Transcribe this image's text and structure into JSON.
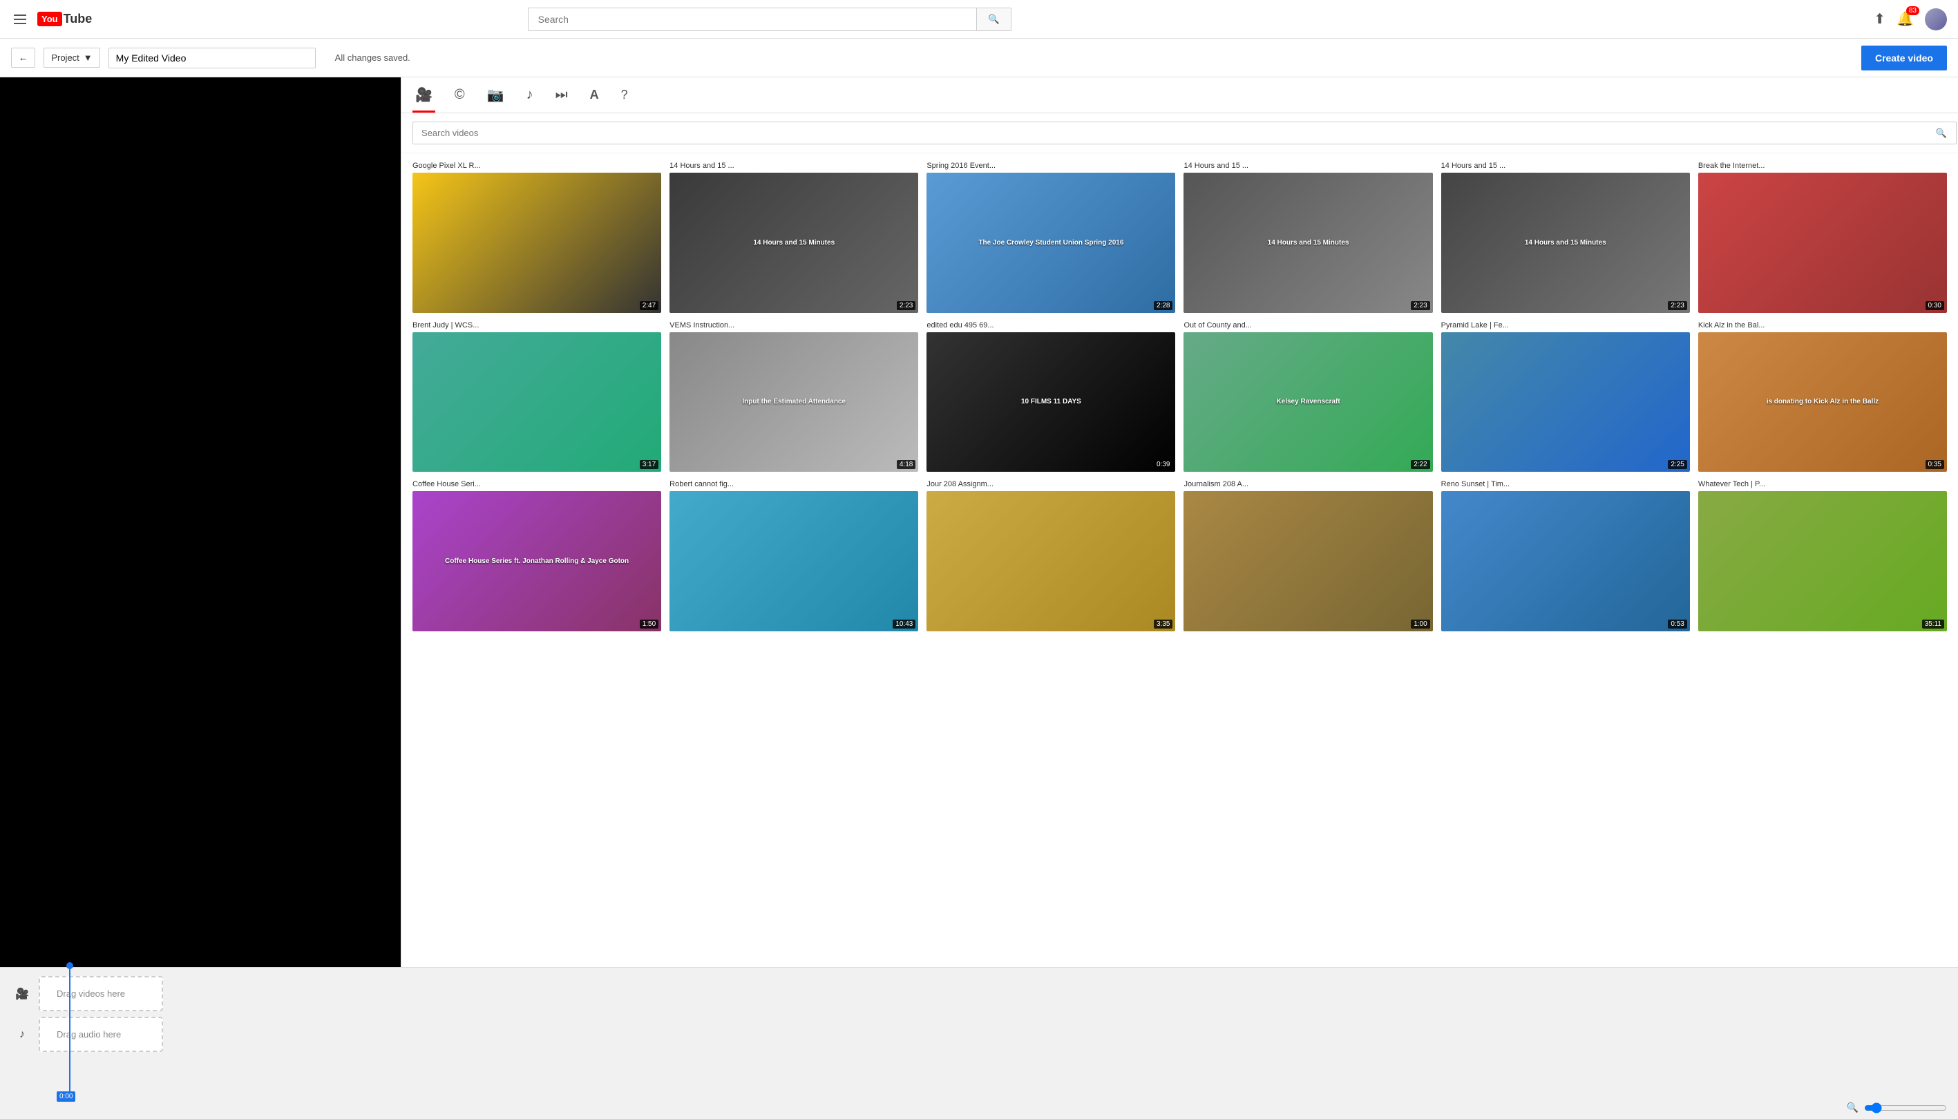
{
  "nav": {
    "search_placeholder": "Search",
    "search_icon": "🔍",
    "upload_label": "Upload",
    "notifications_count": "83",
    "logo_box": "You",
    "logo_text": "Tube"
  },
  "toolbar": {
    "back_label": "←",
    "project_label": "Project",
    "project_dropdown_arrow": "▼",
    "project_name": "My Edited Video",
    "save_status": "All changes saved.",
    "create_video_label": "Create video"
  },
  "tabs": [
    {
      "id": "video",
      "icon": "🎥",
      "active": true
    },
    {
      "id": "captions",
      "icon": "©"
    },
    {
      "id": "photo",
      "icon": "📷"
    },
    {
      "id": "music",
      "icon": "♪"
    },
    {
      "id": "transition",
      "icon": "⏭"
    },
    {
      "id": "text",
      "icon": "A"
    },
    {
      "id": "help",
      "icon": "?"
    }
  ],
  "search": {
    "placeholder": "Search videos"
  },
  "videos": [
    {
      "title": "Google Pixel XL R...",
      "duration": "2:47",
      "thumb_class": "thumb-1",
      "overlay": ""
    },
    {
      "title": "14 Hours and 15 ...",
      "duration": "2:23",
      "thumb_class": "thumb-2",
      "overlay": "14 Hours and 15 Minutes"
    },
    {
      "title": "Spring 2016 Event...",
      "duration": "2:28",
      "thumb_class": "thumb-3",
      "overlay": "The Joe Crowley Student Union Spring 2016"
    },
    {
      "title": "14 Hours and 15 ...",
      "duration": "2:23",
      "thumb_class": "thumb-4",
      "overlay": "14 Hours and 15 Minutes"
    },
    {
      "title": "14 Hours and 15 ...",
      "duration": "2:23",
      "thumb_class": "thumb-5",
      "overlay": "14 Hours and 15 Minutes"
    },
    {
      "title": "Break the Internet...",
      "duration": "0:30",
      "thumb_class": "thumb-6",
      "overlay": ""
    },
    {
      "title": "Brent Judy | WCS...",
      "duration": "3:17",
      "thumb_class": "thumb-7",
      "overlay": ""
    },
    {
      "title": "VEMS Instruction...",
      "duration": "4:18",
      "thumb_class": "thumb-8",
      "overlay": "Input the Estimated Attendance"
    },
    {
      "title": "edited edu 495 69...",
      "duration": "0:39",
      "thumb_class": "thumb-9",
      "overlay": "10 FILMS 11 DAYS"
    },
    {
      "title": "Out of County and...",
      "duration": "2:22",
      "thumb_class": "thumb-10",
      "overlay": "Kelsey Ravenscraft"
    },
    {
      "title": "Pyramid Lake | Fe...",
      "duration": "2:25",
      "thumb_class": "thumb-11",
      "overlay": ""
    },
    {
      "title": "Kick Alz in the Bal...",
      "duration": "0:35",
      "thumb_class": "thumb-12",
      "overlay": "is donating to Kick Alz in the Ballz"
    },
    {
      "title": "Coffee House Seri...",
      "duration": "1:50",
      "thumb_class": "thumb-13",
      "overlay": "Coffee House Series ft. Jonathan Rolling & Jayce Goton"
    },
    {
      "title": "Robert cannot fig...",
      "duration": "10:43",
      "thumb_class": "thumb-14",
      "overlay": ""
    },
    {
      "title": "Jour 208 Assignm...",
      "duration": "3:35",
      "thumb_class": "thumb-15",
      "overlay": ""
    },
    {
      "title": "Journalism 208 A...",
      "duration": "1:00",
      "thumb_class": "thumb-16",
      "overlay": ""
    },
    {
      "title": "Reno Sunset | Tim...",
      "duration": "0:53",
      "thumb_class": "thumb-17",
      "overlay": ""
    },
    {
      "title": "Whatever Tech | P...",
      "duration": "35:11",
      "thumb_class": "thumb-18",
      "overlay": ""
    }
  ],
  "timeline": {
    "video_track_icon": "🎥",
    "audio_track_icon": "♪",
    "drag_video_label": "Drag videos here",
    "drag_audio_label": "Drag audio here",
    "cursor_time": "0:00"
  },
  "zoom": {
    "icon": "🔍"
  }
}
